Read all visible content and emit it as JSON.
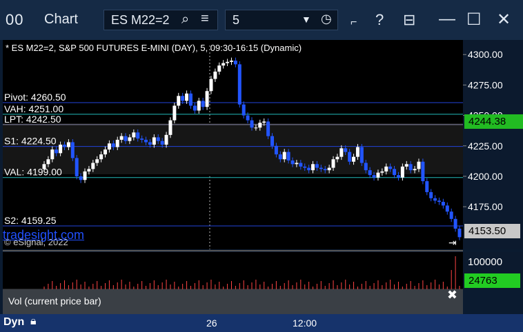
{
  "window": {
    "title": "Chart",
    "symbol": "ES M22=2",
    "interval": "5"
  },
  "chart_data": {
    "type": "candlestick",
    "title": "* ES M22=2, S&P 500 FUTURES E-MINI (DAY), 5, 09:30-16:15 (Dynamic)",
    "y_ticks": [
      "4300.00",
      "4275.00",
      "4250.00",
      "4225.00",
      "4200.00",
      "4175.00"
    ],
    "ylim": [
      4140,
      4312
    ],
    "x_ticks": [
      "26",
      "12:00"
    ],
    "last_price": 4244.38,
    "last_price_label": "4244.38",
    "current_price_label": "4153.50",
    "levels": [
      {
        "label": "Pivot: 4260.50",
        "value": 4260.5,
        "color": "#2244dd"
      },
      {
        "label": "VAH: 4251.00",
        "value": 4251.0,
        "color": "#22bbbb"
      },
      {
        "label": "LPT: 4242.50",
        "value": 4242.5,
        "color": "#8888aa"
      },
      {
        "label": "S1: 4224.50",
        "value": 4224.5,
        "color": "#2244dd"
      },
      {
        "label": "VAL: 4199.00",
        "value": 4199.0,
        "color": "#22bbbb"
      },
      {
        "label": "S2: 4159.25",
        "value": 4159.25,
        "color": "#2244dd"
      }
    ],
    "closes": [
      4210,
      4214,
      4222,
      4219,
      4226,
      4224,
      4228,
      4215,
      4200,
      4197,
      4204,
      4206,
      4211,
      4214,
      4218,
      4222,
      4227,
      4224,
      4230,
      4233,
      4229,
      4232,
      4236,
      4231,
      4230,
      4228,
      4226,
      4232,
      4229,
      4226,
      4234,
      4246,
      4258,
      4266,
      4262,
      4268,
      4258,
      4254,
      4262,
      4257,
      4270,
      4280,
      4286,
      4291,
      4293,
      4294,
      4295,
      4292,
      4259,
      4250,
      4246,
      4240,
      4240,
      4244,
      4245,
      4233,
      4225,
      4218,
      4214,
      4220,
      4213,
      4210,
      4211,
      4208,
      4207,
      4205,
      4210,
      4207,
      4206,
      4205,
      4207,
      4214,
      4216,
      4223,
      4220,
      4212,
      4216,
      4224,
      4211,
      4205,
      4201,
      4199,
      4203,
      4204,
      4208,
      4206,
      4201,
      4199,
      4208,
      4210,
      4205,
      4206,
      4212,
      4196,
      4187,
      4182,
      4180,
      4179,
      4176,
      4171,
      4165,
      4157,
      4150
    ],
    "volume_label": "100000",
    "volume_value": "24763",
    "volume_legend": "Vol (current price bar)",
    "watermark": "tradesight.com",
    "copyright": "© eSignal, 2022"
  },
  "bottom": {
    "label": "Dyn"
  }
}
